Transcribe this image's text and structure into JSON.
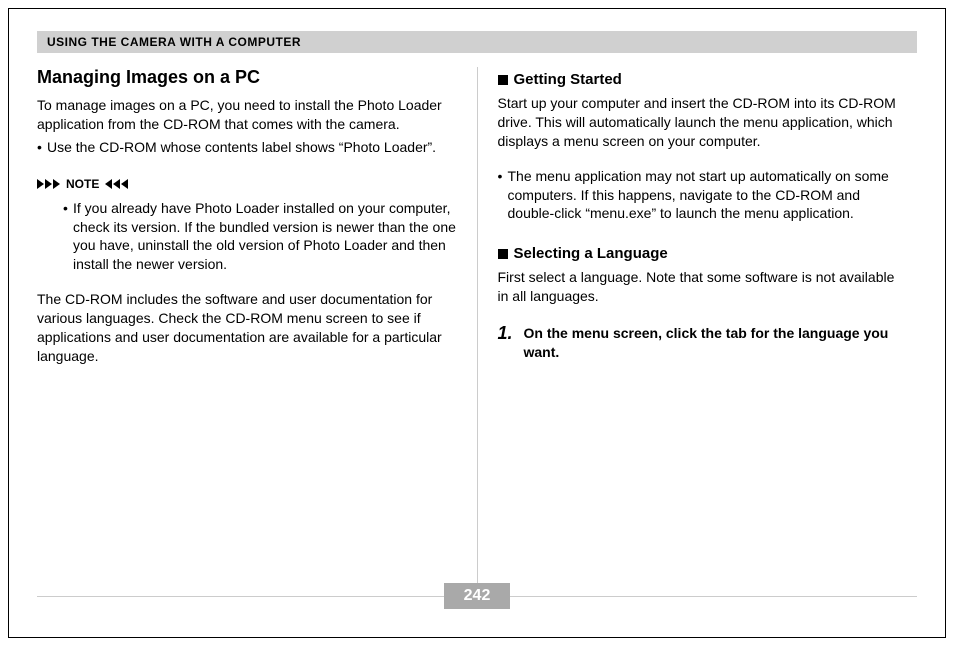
{
  "header": "USING THE CAMERA WITH A COMPUTER",
  "left": {
    "title": "Managing Images on a PC",
    "intro": "To manage images on a PC, you need to install the Photo Loader application from the CD-ROM that comes with the camera.",
    "bullet1": "Use the CD-ROM whose contents label shows “Photo Loader”.",
    "note_label": "NOTE",
    "note_bullet": "If you already have Photo Loader installed on your computer, check its version. If the bundled version is newer than the one you have, uninstall the old version of Photo Loader and then install the newer version.",
    "para2": "The CD-ROM includes the software and user documentation for various languages. Check the CD-ROM menu screen to see if applications and user documentation are available for a particular language."
  },
  "right": {
    "subhead1": "Getting Started",
    "p1": "Start up your computer and insert the CD-ROM into its CD-ROM drive. This will automatically launch the menu application, which displays a menu screen on your computer.",
    "bullet1": "The menu application may not start up automatically on some computers. If this happens, navigate to the CD-ROM and double-click “menu.exe” to launch the menu application.",
    "subhead2": "Selecting a Language",
    "p2": "First select a language. Note that some software is not available in all languages.",
    "step_num": "1.",
    "step_text": "On the menu screen, click the tab for the language you want."
  },
  "page_number": "242"
}
